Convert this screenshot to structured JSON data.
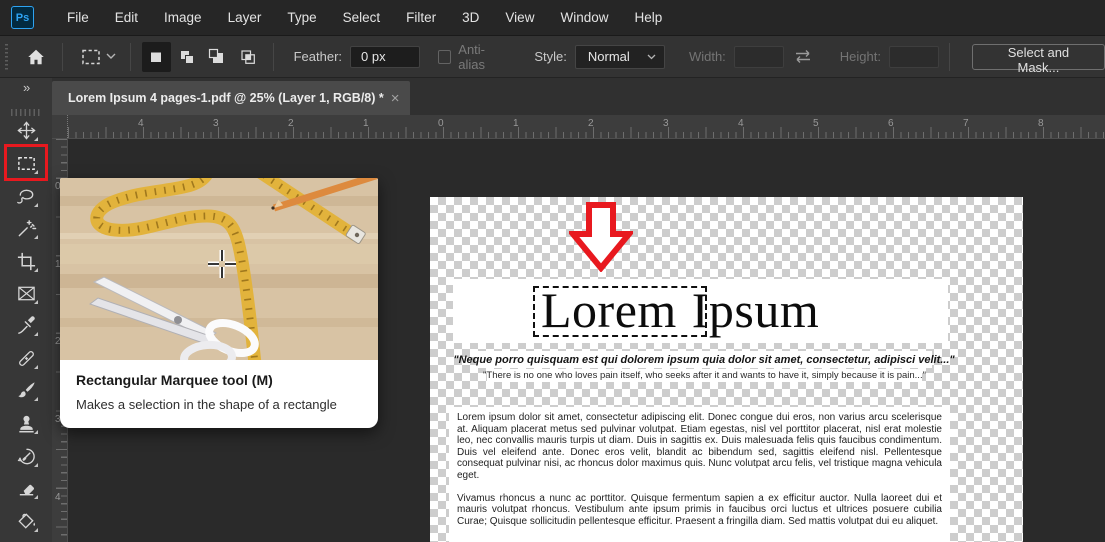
{
  "menubar": {
    "logo_text": "Ps",
    "items": [
      "File",
      "Edit",
      "Image",
      "Layer",
      "Type",
      "Select",
      "Filter",
      "3D",
      "View",
      "Window",
      "Help"
    ]
  },
  "options_bar": {
    "feather_label": "Feather:",
    "feather_value": "0 px",
    "anti_alias_label": "Anti-alias",
    "style_label": "Style:",
    "style_value": "Normal",
    "width_label": "Width:",
    "width_value": "",
    "height_label": "Height:",
    "height_value": "",
    "select_and_mask_label": "Select and Mask..."
  },
  "document_tab": {
    "title": "Lorem Ipsum 4 pages-1.pdf @ 25% (Layer 1, RGB/8) *",
    "close_icon": "×"
  },
  "toolbar": {
    "collapse_icon": "»",
    "tools": [
      "move-tool",
      "rectangular-marquee-tool",
      "lasso-tool",
      "magic-wand-tool",
      "crop-tool",
      "frame-tool",
      "eyedropper-tool",
      "spot-healing-brush-tool",
      "brush-tool",
      "clone-stamp-tool",
      "history-brush-tool",
      "eraser-tool",
      "gradient-tool"
    ],
    "active_tool": "rectangular-marquee-tool"
  },
  "rulers": {
    "horizontal_labels": [
      "4",
      "3",
      "2",
      "1",
      "0",
      "1",
      "2",
      "3",
      "4",
      "5",
      "6",
      "7",
      "8"
    ],
    "vertical_labels": [
      "0",
      "1",
      "2",
      "3",
      "4"
    ]
  },
  "tooltip": {
    "title": "Rectangular Marquee tool (M)",
    "description": "Makes a selection in the shape of a rectangle"
  },
  "canvas": {
    "heading_word_selected": "Lorem",
    "heading_word_rest": "Ipsum",
    "quote_italic": "\"Neque porro quisquam est qui dolorem ipsum quia dolor sit amet, consectetur, adipisci velit...\"",
    "quote_translation": "\"There is no one who loves pain itself, who seeks after it and wants to have it, simply because it is pain...\"",
    "paragraph_1": "Lorem ipsum dolor sit amet, consectetur adipiscing elit. Donec congue dui eros, non varius arcu scelerisque at. Aliquam placerat metus sed pulvinar volutpat. Etiam egestas, nisl vel porttitor placerat, nisl erat molestie leo, nec convallis mauris turpis ut diam. Duis in sagittis ex. Duis malesuada felis quis faucibus condimentum. Duis vel eleifend ante. Donec eros velit, blandit ac bibendum sed, sagittis eleifend nisl. Pellentesque consequat pulvinar nisi, ac rhoncus dolor maximus quis. Nunc volutpat arcu felis, vel tristique magna vehicula eget.",
    "paragraph_2": "Vivamus rhoncus a nunc ac porttitor. Quisque fermentum sapien a ex efficitur auctor. Nulla laoreet dui et mauris volutpat rhoncus. Vestibulum ante ipsum primis in faucibus orci luctus et ultrices posuere cubilia Curae; Quisque sollicitudin pellentesque efficitur. Praesent a fringilla diam. Sed mattis volutpat dui eu aliquet."
  },
  "colors": {
    "annotation_red": "#e8191f",
    "ps_logo_blue": "#2ea3f2",
    "checker_gray": "#cdcdcd"
  }
}
